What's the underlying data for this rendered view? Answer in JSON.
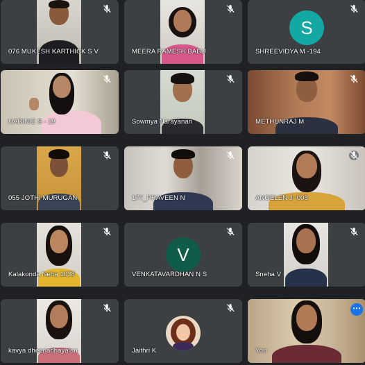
{
  "participants": [
    {
      "name": "076 MUKESH KARTHICK S V",
      "muted": true
    },
    {
      "name": "MEERA RAMESH BABU",
      "muted": true
    },
    {
      "name": "SHREEVIDYA M -194",
      "muted": true,
      "avatar_letter": "S",
      "avatar_color": "#13a8a4"
    },
    {
      "name": "HARINIE S - 19",
      "muted": true
    },
    {
      "name": "Sowmya Narayanan",
      "muted": true
    },
    {
      "name": "METHUNRAJ M",
      "muted": true
    },
    {
      "name": "055 JOTHI MURUGAN",
      "muted": true
    },
    {
      "name": "177_PRAVEEN N",
      "muted": true
    },
    {
      "name": "ANGELEN J -008",
      "muted": true
    },
    {
      "name": "Kalakonda Neha 1038",
      "muted": true
    },
    {
      "name": "VENKATAVARDHAN N S",
      "muted": true,
      "avatar_letter": "V",
      "avatar_color": "#0f5c4a"
    },
    {
      "name": "Sneha V",
      "muted": true
    },
    {
      "name": "kavya dheenadhayalan",
      "muted": true
    },
    {
      "name": "Jaithri K",
      "muted": true
    },
    {
      "name": "You",
      "muted": false,
      "more_icon": "more-options-icon"
    }
  ],
  "colors": {
    "background": "#202124",
    "tile": "#3c4043",
    "accent": "#1a73e8"
  }
}
